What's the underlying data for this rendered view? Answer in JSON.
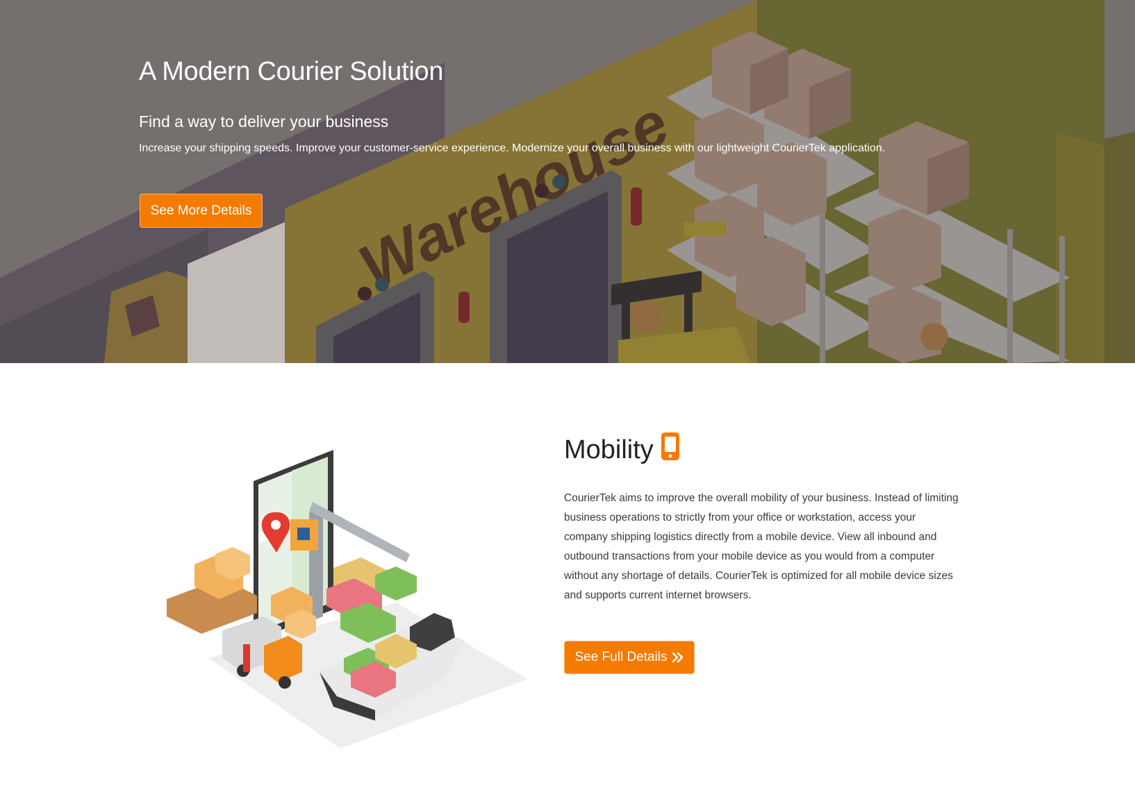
{
  "hero": {
    "title": "A Modern Courier Solution",
    "subtitle": "Find a way to deliver your business",
    "description": "Increase your shipping speeds. Improve your customer-service experience. Modernize your overall business with our lightweight CourierTek application.",
    "button_label": "See More Details",
    "sign_text": "Warehouse"
  },
  "mobility": {
    "title": "Mobility",
    "icon": "mobile-phone-icon",
    "body": "CourierTek aims to improve the overall mobility of your business. Instead of limiting business operations to strictly from your office or workstation, access your company shipping logistics directly from a mobile device. View all inbound and outbound transactions from your mobile device as you would from a computer without any shortage of details. CourierTek is optimized for all mobile device sizes and supports current internet browsers.",
    "button_label": "See Full Details",
    "button_icon": "double-chevron-right-icon"
  },
  "colors": {
    "accent": "#f57a00",
    "hero_overlay": "#7a7473",
    "text_dark": "#3a3a3a"
  }
}
